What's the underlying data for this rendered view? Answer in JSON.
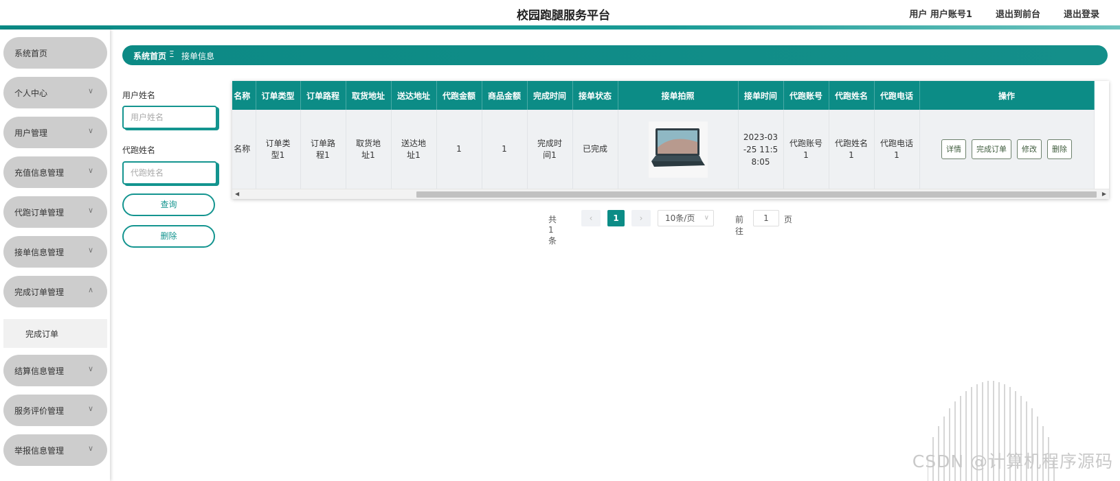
{
  "header": {
    "title": "校园跑腿服务平台",
    "user_label": "用户 用户账号1",
    "to_front_label": "退出到前台",
    "logout_label": "退出登录"
  },
  "sidebar": {
    "items": [
      {
        "label": "系统首页"
      },
      {
        "label": "个人中心"
      },
      {
        "label": "用户管理"
      },
      {
        "label": "充值信息管理"
      },
      {
        "label": "代跑订单管理"
      },
      {
        "label": "接单信息管理"
      },
      {
        "label": "完成订单管理"
      },
      {
        "label": "结算信息管理"
      },
      {
        "label": "服务评价管理"
      },
      {
        "label": "举报信息管理"
      }
    ],
    "submenu": {
      "label": "完成订单"
    }
  },
  "breadcrumb": {
    "home": "系统首页",
    "separator": "Ξ",
    "current": "接单信息"
  },
  "search": {
    "user_name_label": "用户姓名",
    "user_name_placeholder": "用户姓名",
    "runner_name_label": "代跑姓名",
    "runner_name_placeholder": "代跑姓名",
    "query_label": "查询",
    "delete_label": "删除"
  },
  "table": {
    "headers": [
      "名称",
      "订单类型",
      "订单路程",
      "取货地址",
      "送达地址",
      "代跑金额",
      "商品金额",
      "完成时间",
      "接单状态",
      "接单拍照",
      "接单时间",
      "代跑账号",
      "代跑姓名",
      "代跑电话",
      "操作"
    ],
    "row": {
      "name": "名称",
      "order_type": "订单类型1",
      "distance": "订单路程1",
      "pickup": "取货地址1",
      "delivery": "送达地址1",
      "run_fee": "1",
      "goods_amount": "1",
      "finish_time": "完成时间1",
      "status": "已完成",
      "accept_time": "2023-03-25 11:58:05",
      "runner_account": "代跑账号1",
      "runner_name": "代跑姓名1",
      "runner_phone": "代跑电话1"
    },
    "actions": {
      "detail": "详情",
      "complete": "完成订单",
      "edit": "修改",
      "delete": "删除"
    }
  },
  "pagination": {
    "total": "共 1 条",
    "current_page": "1",
    "page_size": "10条/页",
    "goto_label": "前往",
    "goto_value": "1",
    "page_unit": "页"
  },
  "watermark": "CSDN @计算机程序源码",
  "colors": {
    "accent": "#0c8c86",
    "menu_bg": "#cdcdcd"
  }
}
